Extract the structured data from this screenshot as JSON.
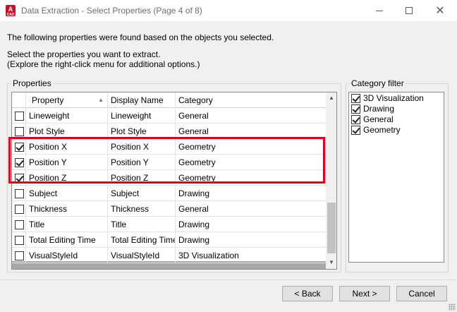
{
  "window": {
    "title": "Data Extraction - Select Properties (Page 4 of 8)",
    "app_icon": "A",
    "app_icon_sub": "CAD",
    "minimize_icon": "minimize-icon",
    "maximize_icon": "maximize-icon",
    "close_icon": "close-icon"
  },
  "messages": {
    "line1": "The following properties were found based on the objects you selected.",
    "line2": "Select the properties you want to extract.",
    "line3": "(Explore the right-click menu for additional options.)"
  },
  "properties": {
    "group_label": "Properties",
    "columns": [
      "Property",
      "Display Name",
      "Category"
    ],
    "sort_indicator": "▲",
    "rows": [
      {
        "checked": false,
        "property": "Lineweight",
        "display": "Lineweight",
        "category": "General"
      },
      {
        "checked": false,
        "property": "Plot Style",
        "display": "Plot Style",
        "category": "General"
      },
      {
        "checked": true,
        "property": "Position X",
        "display": "Position X",
        "category": "Geometry"
      },
      {
        "checked": true,
        "property": "Position Y",
        "display": "Position Y",
        "category": "Geometry"
      },
      {
        "checked": true,
        "property": "Position Z",
        "display": "Position Z",
        "category": "Geometry"
      },
      {
        "checked": false,
        "property": "Subject",
        "display": "Subject",
        "category": "Drawing"
      },
      {
        "checked": false,
        "property": "Thickness",
        "display": "Thickness",
        "category": "General"
      },
      {
        "checked": false,
        "property": "Title",
        "display": "Title",
        "category": "Drawing"
      },
      {
        "checked": false,
        "property": "Total Editing Time",
        "display": "Total Editing Time",
        "category": "Drawing"
      },
      {
        "checked": false,
        "property": "VisualStyleId",
        "display": "VisualStyleId",
        "category": "3D Visualization"
      }
    ],
    "highlight_color": "#e0001a"
  },
  "category_filter": {
    "group_label": "Category filter",
    "items": [
      {
        "label": "3D Visualization",
        "checked": true
      },
      {
        "label": "Drawing",
        "checked": true
      },
      {
        "label": "General",
        "checked": true
      },
      {
        "label": "Geometry",
        "checked": true
      }
    ]
  },
  "buttons": {
    "back": "< Back",
    "next": "Next >",
    "cancel": "Cancel"
  }
}
